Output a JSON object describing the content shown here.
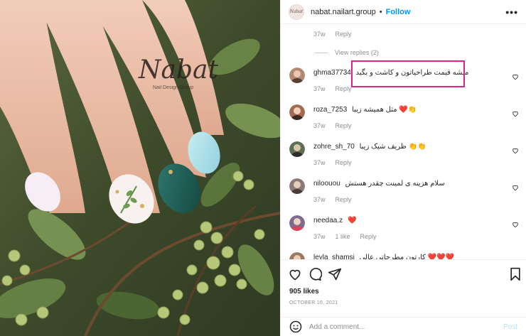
{
  "post": {
    "handle": "nabat.nailart.group",
    "follow_label": "Follow",
    "separator": "•",
    "more_label": "•••",
    "avatar_text": "Nabat",
    "watermark": "Nabat",
    "watermark_sub": "Nail Design Group"
  },
  "top_meta": {
    "time": "37w",
    "reply": "Reply"
  },
  "view_replies": "View replies (2)",
  "comments": [
    {
      "user": "ghma37734",
      "text": "میشه قیمت طراحیاتون و کاشت و بگید",
      "time": "37w",
      "reply": "Reply",
      "likes": "",
      "avatar_color": "#b08a72"
    },
    {
      "user": "roza_7253",
      "text": "مثل همیشه زیبا ❤️👏",
      "time": "37w",
      "reply": "Reply",
      "likes": "",
      "avatar_color": "#a06a55"
    },
    {
      "user": "zohre_sh_70",
      "text": "ظریف شیک زیبا 👏👏",
      "time": "37w",
      "reply": "Reply",
      "likes": "",
      "avatar_color": "#5c6e54"
    },
    {
      "user": "niloouou",
      "text": "سلام هزینه ی لمینت چقدر هستش",
      "time": "37w",
      "reply": "Reply",
      "likes": "",
      "avatar_color": "#8a7a78"
    },
    {
      "user": "needaa.z",
      "text": "❤️",
      "time": "37w",
      "reply": "Reply",
      "likes": "1 like",
      "avatar_color": "#7d6a8f"
    },
    {
      "user": "leyla_shamsi",
      "text": "کارتون مطرحاتی عالی ❤️❤️❤️",
      "time": "",
      "reply": "",
      "likes": "",
      "avatar_color": "#9b7a63"
    }
  ],
  "likes_count": "905 likes",
  "date": "OCTOBER 16, 2021",
  "add_comment": {
    "placeholder": "Add a comment...",
    "post_label": "Post"
  },
  "colors": {
    "accent": "#0095f6",
    "highlight": "#e0218a",
    "heart": "#ed4956",
    "muted": "#8e8e8e"
  },
  "icons": [
    "heart-icon",
    "comment-icon",
    "share-icon",
    "bookmark-icon",
    "emoji-icon",
    "more-icon"
  ]
}
